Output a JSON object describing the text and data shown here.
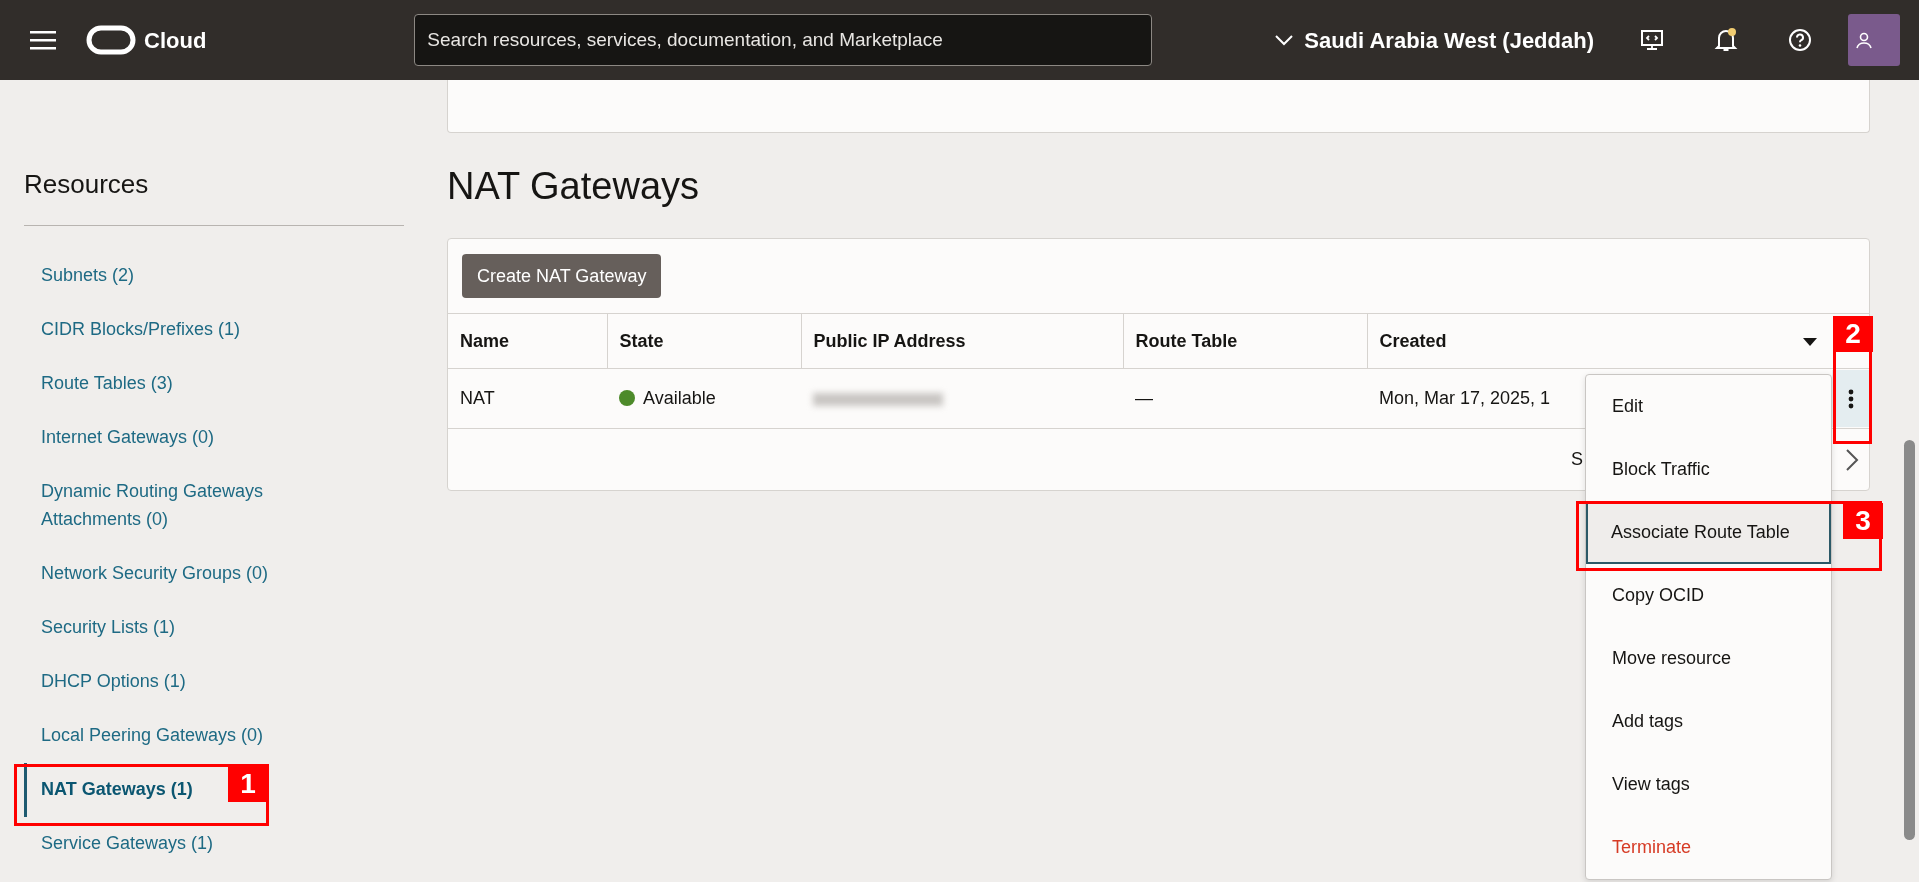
{
  "header": {
    "brand": "Cloud",
    "search": {
      "placeholder": "Search resources, services, documentation, and Marketplace"
    },
    "region": "Saudi Arabia West (Jeddah)",
    "notifications_unread": true
  },
  "sidebar": {
    "title": "Resources",
    "items": [
      {
        "label": "Subnets (2)",
        "selected": false
      },
      {
        "label": "CIDR Blocks/Prefixes (1)",
        "selected": false
      },
      {
        "label": "Route Tables (3)",
        "selected": false
      },
      {
        "label": "Internet Gateways (0)",
        "selected": false
      },
      {
        "label": "Dynamic Routing Gateways Attachments (0)",
        "selected": false
      },
      {
        "label": "Network Security Groups (0)",
        "selected": false
      },
      {
        "label": "Security Lists (1)",
        "selected": false
      },
      {
        "label": "DHCP Options (1)",
        "selected": false
      },
      {
        "label": "Local Peering Gateways (0)",
        "selected": false
      },
      {
        "label": "NAT Gateways (1)",
        "selected": true
      },
      {
        "label": "Service Gateways (1)",
        "selected": false
      }
    ]
  },
  "main": {
    "title": "NAT Gateways",
    "create_button": "Create NAT Gateway",
    "table": {
      "columns": [
        {
          "label": "Name",
          "sorted": false
        },
        {
          "label": "State",
          "sorted": false
        },
        {
          "label": "Public IP Address",
          "sorted": false
        },
        {
          "label": "Route Table",
          "sorted": false
        },
        {
          "label": "Created",
          "sorted": true
        }
      ],
      "rows": [
        {
          "name": "NAT",
          "state": {
            "text": "Available",
            "color": "#4d8a2a"
          },
          "public_ip_blurred": true,
          "route_table": "—",
          "created": "Mon, Mar 17, 2025, 1",
          "menu_open": true
        }
      ],
      "footer_text": "S"
    }
  },
  "action_menu": {
    "items": [
      {
        "label": "Edit",
        "kind": "normal",
        "selected": false
      },
      {
        "label": "Block Traffic",
        "kind": "normal",
        "selected": false
      },
      {
        "label": "Associate Route Table",
        "kind": "normal",
        "selected": true
      },
      {
        "label": "Copy OCID",
        "kind": "normal",
        "selected": false
      },
      {
        "label": "Move resource",
        "kind": "normal",
        "selected": false
      },
      {
        "label": "Add tags",
        "kind": "normal",
        "selected": false
      },
      {
        "label": "View tags",
        "kind": "normal",
        "selected": false
      },
      {
        "label": "Terminate",
        "kind": "danger",
        "selected": false
      }
    ]
  },
  "callouts": [
    {
      "number": "1"
    },
    {
      "number": "2"
    },
    {
      "number": "3"
    }
  ]
}
